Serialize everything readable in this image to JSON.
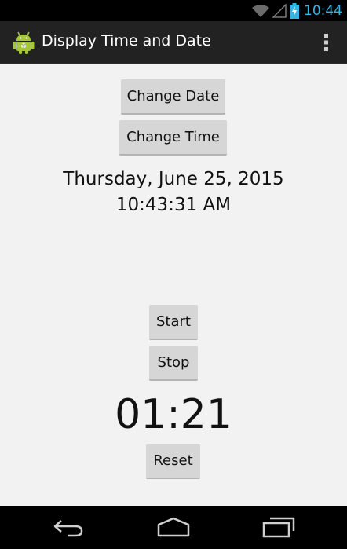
{
  "status_bar": {
    "time": "10:44",
    "icons": [
      "wifi-icon",
      "signal-icon",
      "battery-charging-icon"
    ],
    "time_color": "#33b5e5"
  },
  "action_bar": {
    "app_icon": "android-robot-icon",
    "title": "Display Time and Date",
    "menu_icon": "overflow-menu-icon"
  },
  "main": {
    "change_date_label": "Change Date",
    "change_time_label": "Change Time",
    "date_text": "Thursday, June 25, 2015",
    "time_text": "10:43:31 AM",
    "start_label": "Start",
    "stop_label": "Stop",
    "stopwatch": "01:21",
    "reset_label": "Reset"
  },
  "nav_bar": {
    "icons": [
      "back-icon",
      "home-icon",
      "recent-apps-icon"
    ]
  }
}
